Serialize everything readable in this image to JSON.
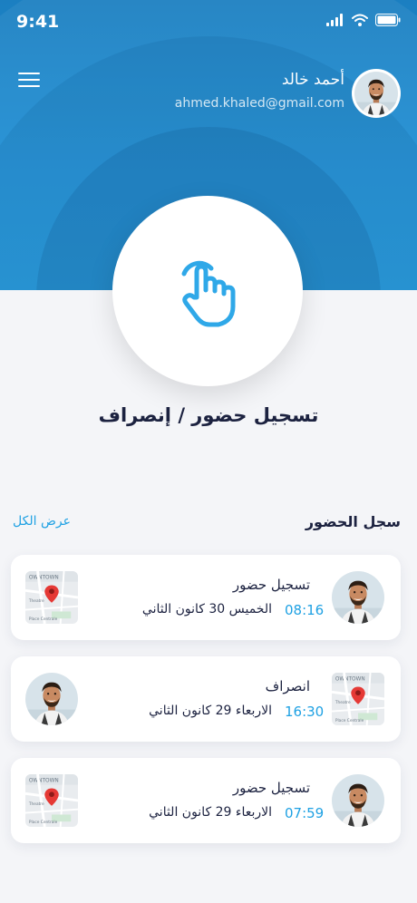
{
  "status_bar": {
    "time": "9:41",
    "icons": [
      "signal-icon",
      "wifi-icon",
      "battery-icon"
    ]
  },
  "user": {
    "name": "أحمد خالد",
    "email": "ahmed.khaled@gmail.com"
  },
  "action": {
    "title": "تسجيل حضور / إنصراف",
    "icon": "tap-hand-icon"
  },
  "log": {
    "title": "سجل الحضور",
    "view_all": "عرض الكل",
    "entries": [
      {
        "label": "تسجيل حضور",
        "time": "08:16",
        "date": "الخميس 30 كانون الثاني"
      },
      {
        "label": "انصراف",
        "time": "16:30",
        "date": "الاربعاء 29 كانون الثاني"
      },
      {
        "label": "تسجيل حضور",
        "time": "07:59",
        "date": "الاربعاء 29 كانون الثاني"
      }
    ]
  },
  "colors": {
    "primary": "#1e90d6",
    "accent": "#1fa1e3",
    "text": "#1c2240"
  }
}
